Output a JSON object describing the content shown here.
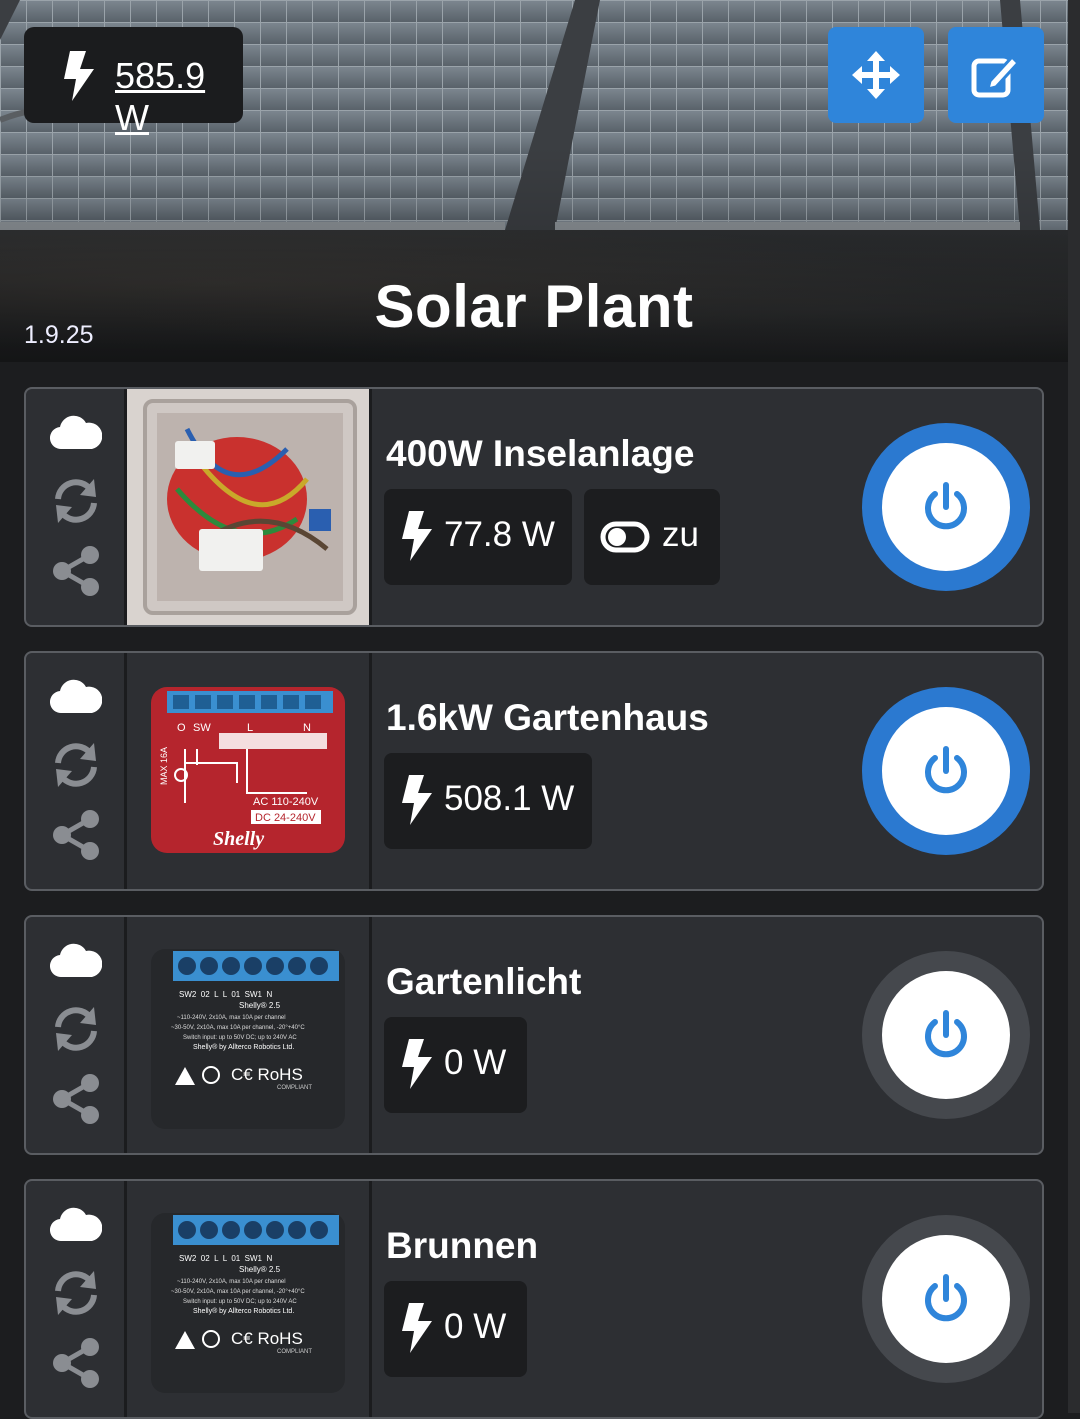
{
  "header": {
    "total_power": "585.9 W",
    "title": "Solar Plant",
    "version": "1.9.25"
  },
  "colors": {
    "accent": "#2f85da",
    "power_on_ring": "#2b79d0",
    "power_off_ring": "#45484d",
    "card_bg": "#2d2f33",
    "chip_bg": "#1c1d1f"
  },
  "devices": [
    {
      "name": "400W Inselanlage",
      "power": "77.8 W",
      "state": "zu",
      "on": true
    },
    {
      "name": "1.6kW Gartenhaus",
      "power": "508.1 W",
      "on": true
    },
    {
      "name": "Gartenlicht",
      "power": "0 W",
      "on": false
    },
    {
      "name": "Brunnen",
      "power": "0 W",
      "on": false
    }
  ],
  "thumb1_labels": {
    "top_left": "O",
    "sw": "SW",
    "l": "L",
    "n": "N",
    "max": "MAX 16A",
    "ac": "AC 110-240V",
    "dc": "DC 24-240V",
    "brand": "Shelly"
  },
  "thumb2_labels": {
    "model": "Shelly® 2.5",
    "terminals": "SW2  02  L  L  01  SW1  N",
    "spec1": "~110-240V, 2x10A, max 10A per channel",
    "spec2": "~30-50V, 2x10A, max 10A per channel, -20°+40°C",
    "spec3": "Switch input: up to 50V DC; up to 240V AC",
    "maker": "Shelly® by Allterco Robotics Ltd.",
    "cert": "C€ RoHS",
    "compliant": "COMPLIANT"
  }
}
